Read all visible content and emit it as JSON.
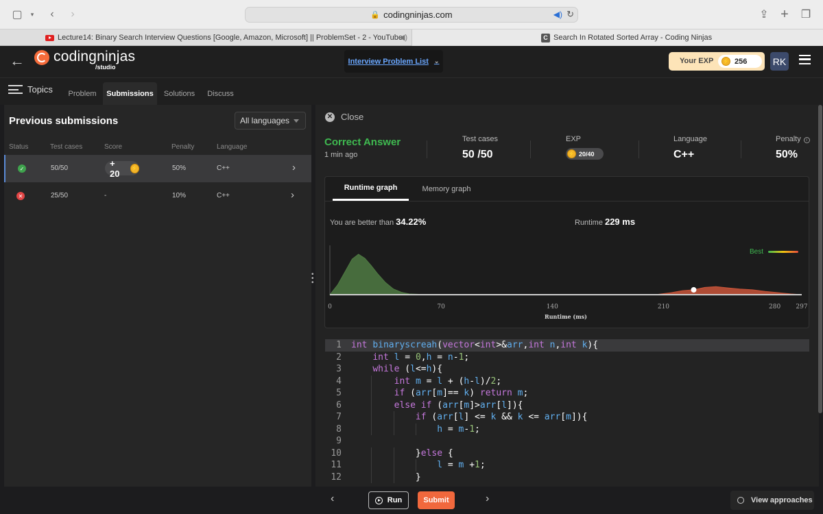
{
  "browser": {
    "url": "codingninjas.com",
    "tabs": [
      {
        "title": "Lecture14: Binary Search Interview Questions [Google, Amazon, Microsoft] || ProblemSet - 2 - YouTube"
      },
      {
        "title": "Search In Rotated Sorted Array - Coding Ninjas"
      }
    ]
  },
  "header": {
    "logo_text": "codingninjas",
    "logo_sub": "/studio",
    "problem_list": "Interview Problem List",
    "exp_label": "Your EXP",
    "exp_value": "256",
    "avatar": "RK"
  },
  "nav": {
    "topics": "Topics",
    "tabs": [
      "Problem",
      "Submissions",
      "Solutions",
      "Discuss"
    ],
    "active": "Submissions"
  },
  "submissions": {
    "title": "Previous submissions",
    "language_filter": "All languages",
    "columns": [
      "Status",
      "Test cases",
      "Score",
      "Penalty",
      "Language"
    ],
    "rows": [
      {
        "status": "success",
        "test_cases": "50/50",
        "score": "+ 20",
        "penalty": "50%",
        "language": "C++"
      },
      {
        "status": "failed",
        "test_cases": "25/50",
        "score": "-",
        "penalty": "10%",
        "language": "C++"
      }
    ]
  },
  "detail": {
    "close": "Close",
    "result": "Correct Answer",
    "time_ago": "1 min ago",
    "test_cases_label": "Test cases",
    "test_cases_value": "50 /50",
    "exp_label": "EXP",
    "exp_value": "20/40",
    "language_label": "Language",
    "language_value": "C++",
    "penalty_label": "Penalty",
    "penalty_value": "50%",
    "graph_tabs": [
      "Runtime graph",
      "Memory graph"
    ],
    "better_than_label": "You are better than",
    "better_than_value": "34.22%",
    "runtime_label": "Runtime",
    "runtime_value": "229 ms",
    "best_label": "Best"
  },
  "chart_data": {
    "type": "area",
    "xlabel": "Runtime (ms)",
    "x_ticks": [
      0,
      70,
      140,
      210,
      280,
      297
    ],
    "xlim": [
      0,
      297
    ],
    "ylim": [
      0,
      1
    ],
    "grid": false,
    "series": [
      {
        "color": "#4f7a43",
        "x": [
          0,
          5,
          10,
          14,
          18,
          22,
          26,
          30,
          35,
          40,
          45,
          50,
          55,
          60
        ],
        "y": [
          0,
          0.25,
          0.6,
          0.88,
          1.0,
          0.9,
          0.72,
          0.52,
          0.3,
          0.14,
          0.06,
          0.02,
          0.01,
          0
        ]
      },
      {
        "color": "#c9553a",
        "x": [
          205,
          215,
          222,
          229,
          236,
          243,
          250,
          258,
          266,
          274,
          282,
          290,
          297
        ],
        "y": [
          0,
          0.05,
          0.1,
          0.12,
          0.18,
          0.2,
          0.17,
          0.14,
          0.12,
          0.08,
          0.05,
          0.02,
          0
        ]
      }
    ],
    "marker": {
      "x": 229,
      "y": 0.12
    }
  },
  "code": [
    "int binaryscreah(vector<int>&arr,int n,int k){",
    "    int l = 0,h = n-1;",
    "    while (l<=h){",
    "        int m = l + (h-l)/2;",
    "        if (arr[m]== k) return m;",
    "        else if (arr[m]>arr[l]){",
    "            if (arr[l] <= k && k <= arr[m]){",
    "                h = m-1;",
    "",
    "            }else {",
    "                l = m +1;",
    "            }"
  ],
  "bottom": {
    "run": "Run",
    "submit": "Submit",
    "view_approaches": "View approaches"
  }
}
